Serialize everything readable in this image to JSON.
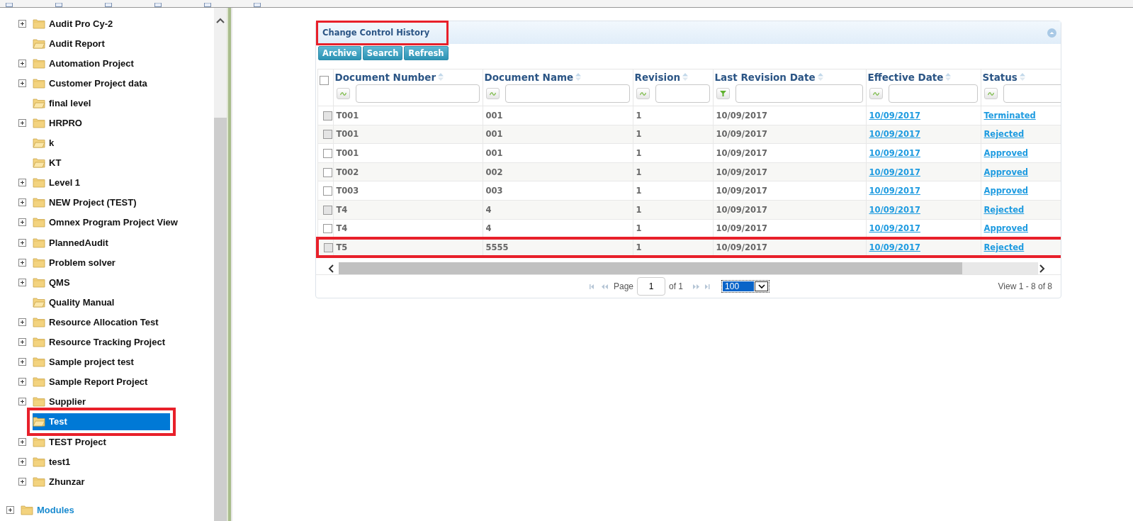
{
  "tree": {
    "items": [
      {
        "label": "Audit Pro Cy-2",
        "expandable": true,
        "selected": false,
        "annotated": false
      },
      {
        "label": "Audit Report",
        "expandable": false,
        "selected": false,
        "annotated": false
      },
      {
        "label": "Automation Project",
        "expandable": true,
        "selected": false,
        "annotated": false
      },
      {
        "label": "Customer Project data",
        "expandable": true,
        "selected": false,
        "annotated": false
      },
      {
        "label": "final level",
        "expandable": false,
        "selected": false,
        "annotated": false
      },
      {
        "label": "HRPRO",
        "expandable": true,
        "selected": false,
        "annotated": false
      },
      {
        "label": "k",
        "expandable": false,
        "selected": false,
        "annotated": false
      },
      {
        "label": "KT",
        "expandable": false,
        "selected": false,
        "annotated": false
      },
      {
        "label": "Level 1",
        "expandable": true,
        "selected": false,
        "annotated": false
      },
      {
        "label": "NEW Project (TEST)",
        "expandable": true,
        "selected": false,
        "annotated": false
      },
      {
        "label": "Omnex Program Project View",
        "expandable": true,
        "selected": false,
        "annotated": false
      },
      {
        "label": "PlannedAudit",
        "expandable": true,
        "selected": false,
        "annotated": false
      },
      {
        "label": "Problem solver",
        "expandable": true,
        "selected": false,
        "annotated": false
      },
      {
        "label": "QMS",
        "expandable": true,
        "selected": false,
        "annotated": false
      },
      {
        "label": "Quality Manual",
        "expandable": false,
        "selected": false,
        "annotated": false
      },
      {
        "label": "Resource Allocation Test",
        "expandable": true,
        "selected": false,
        "annotated": false
      },
      {
        "label": "Resource Tracking Project",
        "expandable": true,
        "selected": false,
        "annotated": false
      },
      {
        "label": "Sample project test",
        "expandable": true,
        "selected": false,
        "annotated": false
      },
      {
        "label": "Sample Report Project",
        "expandable": true,
        "selected": false,
        "annotated": false
      },
      {
        "label": "Supplier",
        "expandable": true,
        "selected": false,
        "annotated": false
      },
      {
        "label": "Test",
        "expandable": false,
        "selected": true,
        "annotated": true
      },
      {
        "label": "TEST Project",
        "expandable": true,
        "selected": false,
        "annotated": false
      },
      {
        "label": "test1",
        "expandable": true,
        "selected": false,
        "annotated": false
      },
      {
        "label": "Zhunzar",
        "expandable": true,
        "selected": false,
        "annotated": false
      }
    ],
    "root_items": [
      {
        "label": "Modules",
        "expandable": true
      }
    ]
  },
  "panel": {
    "title": "Change Control History",
    "title_annotated": true,
    "select_all_checked": false,
    "buttons": [
      "Archive",
      "Search",
      "Refresh"
    ],
    "columns": [
      {
        "label": "Document Number",
        "kind": "wave"
      },
      {
        "label": "Document Name",
        "kind": "wave"
      },
      {
        "label": "Revision",
        "kind": "wave"
      },
      {
        "label": "Last Revision Date",
        "kind": "funnel"
      },
      {
        "label": "Effective Date",
        "kind": "wave"
      },
      {
        "label": "Status",
        "kind": "wave"
      }
    ],
    "rows": [
      {
        "cells": [
          "T001",
          "001",
          "1",
          "10/09/2017",
          "10/09/2017",
          "Terminated"
        ],
        "disabled": true,
        "annotated": false
      },
      {
        "cells": [
          "T001",
          "001",
          "1",
          "10/09/2017",
          "10/09/2017",
          "Rejected"
        ],
        "disabled": true,
        "annotated": false
      },
      {
        "cells": [
          "T001",
          "001",
          "1",
          "10/09/2017",
          "10/09/2017",
          "Approved"
        ],
        "disabled": false,
        "annotated": false
      },
      {
        "cells": [
          "T002",
          "002",
          "1",
          "10/09/2017",
          "10/09/2017",
          "Approved"
        ],
        "disabled": false,
        "annotated": false
      },
      {
        "cells": [
          "T003",
          "003",
          "1",
          "10/09/2017",
          "10/09/2017",
          "Approved"
        ],
        "disabled": false,
        "annotated": false
      },
      {
        "cells": [
          "T4",
          "4",
          "1",
          "10/09/2017",
          "10/09/2017",
          "Rejected"
        ],
        "disabled": true,
        "annotated": false
      },
      {
        "cells": [
          "T4",
          "4",
          "1",
          "10/09/2017",
          "10/09/2017",
          "Approved"
        ],
        "disabled": false,
        "annotated": false
      },
      {
        "cells": [
          "T5",
          "5555",
          "1",
          "10/09/2017",
          "10/09/2017",
          "Rejected"
        ],
        "disabled": true,
        "annotated": true
      }
    ],
    "pager": {
      "page_label": "Page",
      "page": "1",
      "of_label": "of 1",
      "page_size": "100",
      "summary": "View 1 - 8 of 8"
    }
  }
}
